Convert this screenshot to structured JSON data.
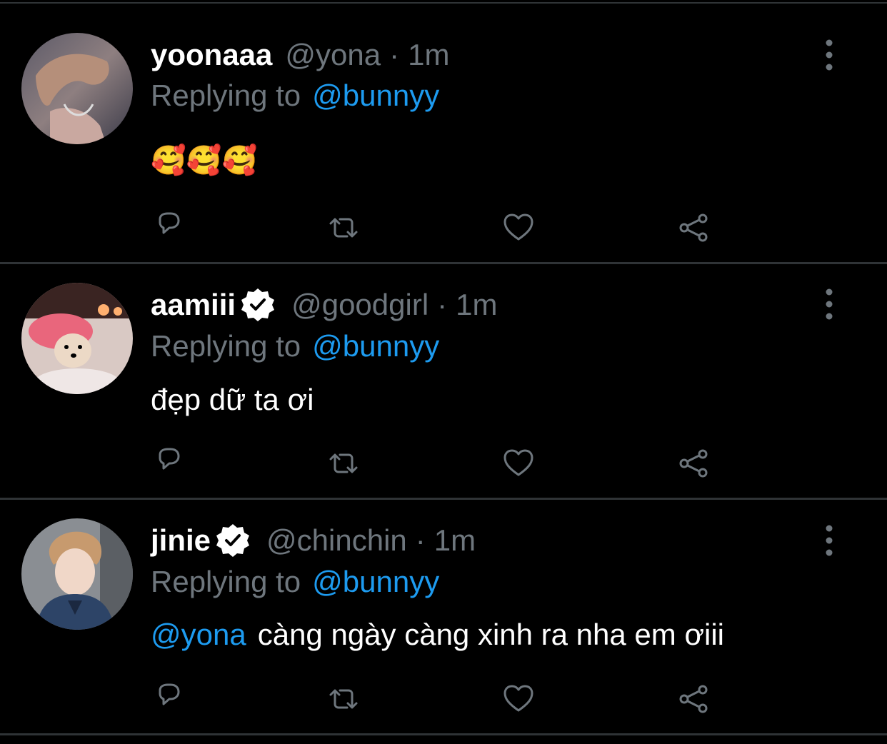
{
  "tweets": [
    {
      "name": "yoonaaa",
      "verified": false,
      "handle": "@yona",
      "separator": "·",
      "time": "1m",
      "replying_prefix": "Replying to",
      "replying_to": "@bunnyy",
      "body_mention": "",
      "body_text": "🥰🥰🥰",
      "actions": [
        "reply-icon",
        "retweet-icon",
        "like-icon",
        "share-icon"
      ]
    },
    {
      "name": "aamiii",
      "verified": true,
      "handle": "@goodgirl",
      "separator": "·",
      "time": "1m",
      "replying_prefix": "Replying to",
      "replying_to": "@bunnyy",
      "body_mention": "",
      "body_text": "đẹp dữ ta ơi",
      "actions": [
        "reply-icon",
        "retweet-icon",
        "like-icon",
        "share-icon"
      ]
    },
    {
      "name": "jinie",
      "verified": true,
      "handle": "@chinchin",
      "separator": "·",
      "time": "1m",
      "replying_prefix": "Replying to",
      "replying_to": "@bunnyy",
      "body_mention": "@yona",
      "body_text": "càng ngày càng xinh ra nha em ơiii",
      "actions": [
        "reply-icon",
        "retweet-icon",
        "like-icon",
        "share-icon"
      ]
    }
  ],
  "colors": {
    "background": "#000000",
    "secondary_text": "#6e767d",
    "link": "#1d9bf0",
    "divider": "#2f3336"
  }
}
